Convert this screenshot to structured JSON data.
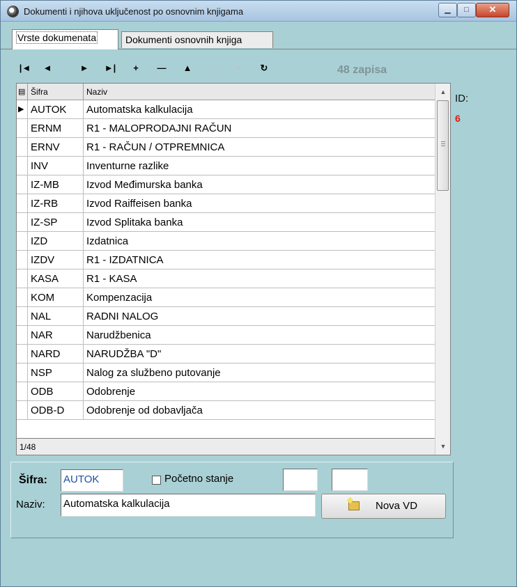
{
  "window": {
    "title": "Dokumenti i njihova uključenost po osnovnim knjigama",
    "controls": {
      "minimize": "▁",
      "maximize": "□",
      "close": "✕"
    }
  },
  "tabs": [
    {
      "label": "Vrste dokumenata",
      "active": true
    },
    {
      "label": "Dokumenti osnovnih knjiga",
      "active": false
    }
  ],
  "toolbar": {
    "buttons": [
      {
        "name": "first-record",
        "glyph": "|◄",
        "enabled": true
      },
      {
        "name": "prior-record",
        "glyph": "◄",
        "enabled": true
      },
      {
        "name": "next-record",
        "glyph": "►",
        "enabled": true
      },
      {
        "name": "last-record",
        "glyph": "►|",
        "enabled": true
      },
      {
        "name": "insert-record",
        "glyph": "+",
        "enabled": true
      },
      {
        "name": "delete-record",
        "glyph": "—",
        "enabled": true
      },
      {
        "name": "edit-record",
        "glyph": "▲",
        "enabled": true
      },
      {
        "name": "post-edit",
        "glyph": "✓",
        "enabled": false
      },
      {
        "name": "cancel-edit",
        "glyph": "✕",
        "enabled": false
      },
      {
        "name": "refresh-data",
        "glyph": "↻",
        "enabled": true
      }
    ],
    "record_count": "48 zapisa"
  },
  "grid": {
    "columns": {
      "indicator": "",
      "code": "Šifra",
      "name": "Naziv"
    },
    "rows": [
      {
        "code": "AUTOK",
        "name": "Automatska kalkulacija",
        "current": true
      },
      {
        "code": "ERNM",
        "name": "R1 - MALOPRODAJNI RAČUN"
      },
      {
        "code": "ERNV",
        "name": "R1 -  RAČUN / OTPREMNICA"
      },
      {
        "code": "INV",
        "name": "Inventurne razlike"
      },
      {
        "code": "IZ-MB",
        "name": "Izvod Međimurska banka"
      },
      {
        "code": "IZ-RB",
        "name": "Izvod Raiffeisen banka"
      },
      {
        "code": "IZ-SP",
        "name": "Izvod Splitaka banka"
      },
      {
        "code": "IZD",
        "name": "Izdatnica"
      },
      {
        "code": "IZDV",
        "name": "R1 - IZDATNICA"
      },
      {
        "code": "KASA",
        "name": "R1 - KASA"
      },
      {
        "code": "KOM",
        "name": "Kompenzacija"
      },
      {
        "code": "NAL",
        "name": "RADNI NALOG"
      },
      {
        "code": "NAR",
        "name": "Narudžbenica"
      },
      {
        "code": "NARD",
        "name": "NARUDŽBA   \"D\""
      },
      {
        "code": "NSP",
        "name": "Nalog za službeno putovanje"
      },
      {
        "code": "ODB",
        "name": "Odobrenje"
      },
      {
        "code": "ODB-D",
        "name": "Odobrenje od dobavljača"
      }
    ],
    "position": "1/48",
    "scrollbar": {
      "up": "▲",
      "down": "▼"
    }
  },
  "side": {
    "id_label": "ID:",
    "id_value": "6"
  },
  "form": {
    "sifra_label": "Šifra:",
    "sifra_value": "AUTOK",
    "pocetno_label": "Početno stanje",
    "pocetno_checked": false,
    "field1_value": "",
    "field2_value": "",
    "naziv_label": "Naziv:",
    "naziv_value": "Automatska kalkulacija",
    "nova_button": "Nova VD"
  }
}
